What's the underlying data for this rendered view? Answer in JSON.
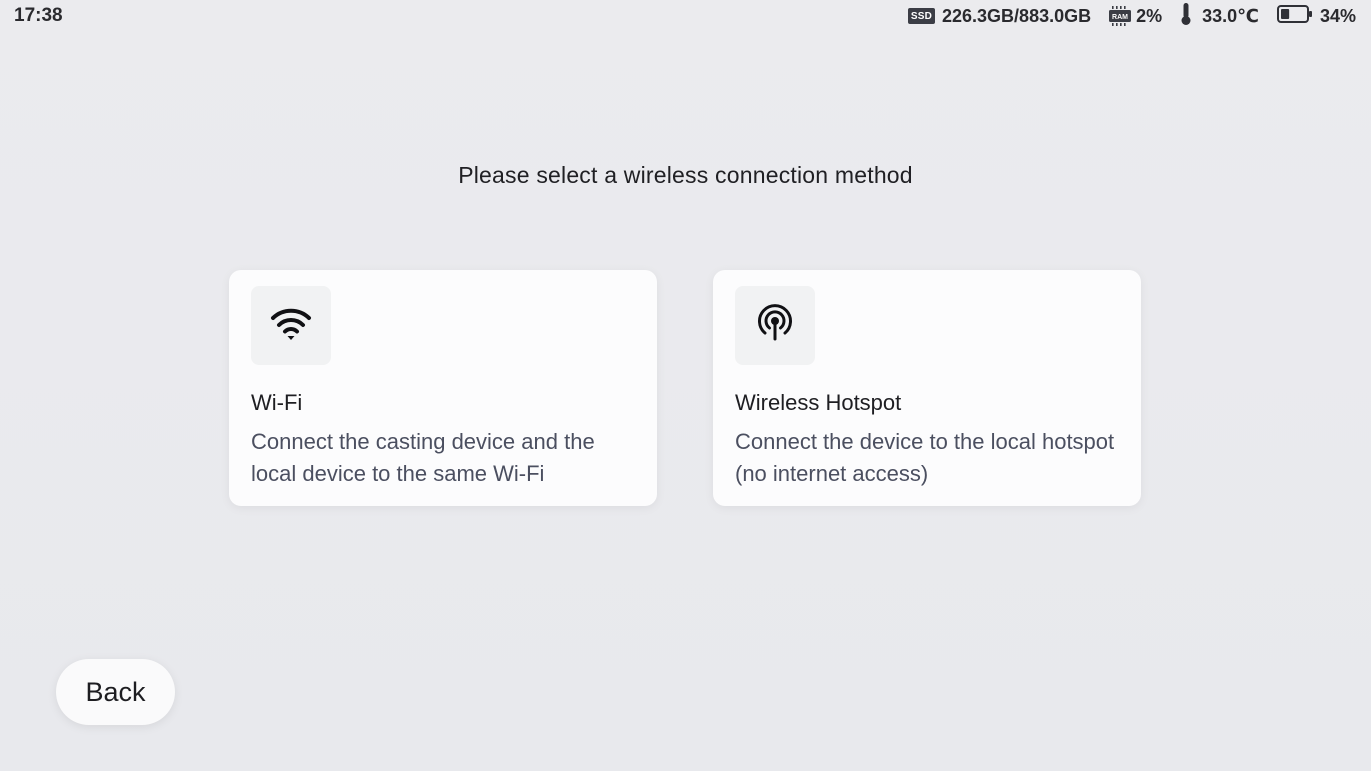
{
  "status_bar": {
    "time": "17:38",
    "ssd": {
      "badge": "SSD",
      "value": "226.3GB/883.0GB"
    },
    "ram": {
      "badge": "RAM",
      "value": "2%"
    },
    "temperature": {
      "value": "33.0℃"
    },
    "battery": {
      "value": "34%",
      "level": 0.34
    }
  },
  "prompt": "Please select a wireless connection method",
  "options": [
    {
      "icon": "wifi-icon",
      "title": "Wi-Fi",
      "description": "Connect the casting device and the local device to the same Wi-Fi"
    },
    {
      "icon": "hotspot-icon",
      "title": "Wireless Hotspot",
      "description": "Connect the device to the local hotspot (no internet access)"
    }
  ],
  "back_label": "Back",
  "colors": {
    "background": "#e9eaee",
    "card": "#fcfcfd",
    "icon_box": "#f1f2f3",
    "text_primary": "#1e1e22",
    "text_secondary": "#4b4f60"
  }
}
